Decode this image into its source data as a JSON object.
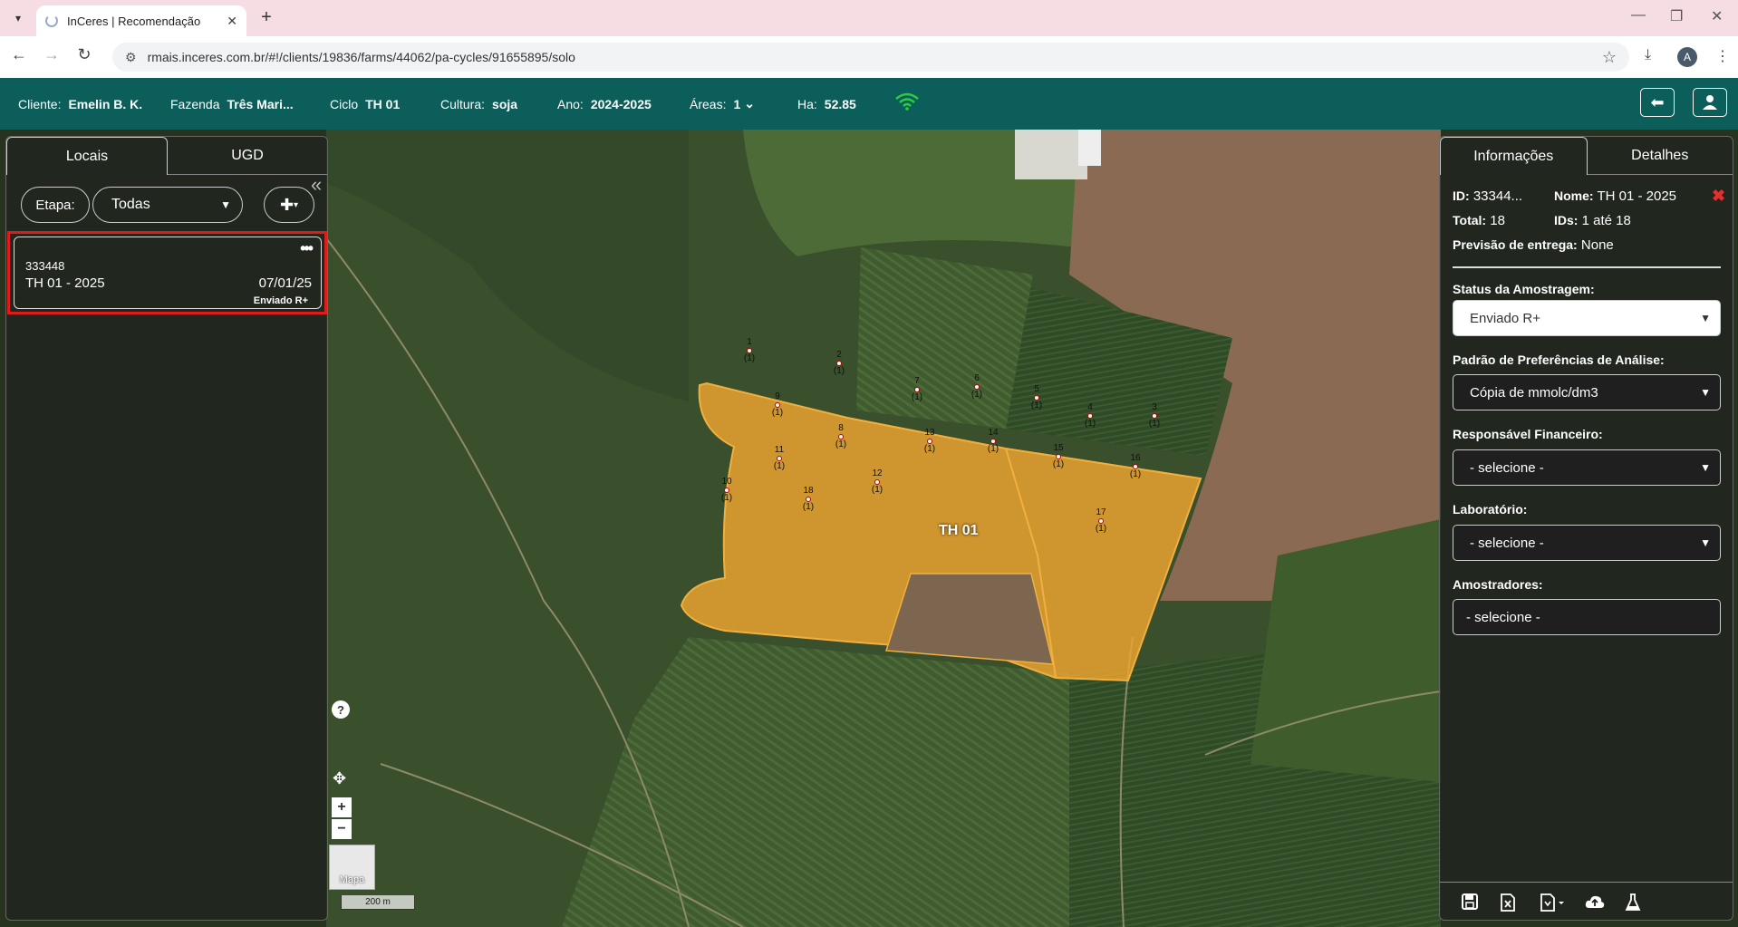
{
  "browser": {
    "tab_title": "InCeres | Recomendação",
    "url": "rmais.inceres.com.br/#!/clients/19836/farms/44062/pa-cycles/91655895/solo",
    "profile_initial": "A"
  },
  "header": {
    "cliente_label": "Cliente:",
    "cliente_value": "Emelin B. K.",
    "fazenda_label": "Fazenda",
    "fazenda_value": "Três Mari...",
    "ciclo_label": "Ciclo",
    "ciclo_value": "TH 01",
    "cultura_label": "Cultura:",
    "cultura_value": "soja",
    "ano_label": "Ano:",
    "ano_value": "2024-2025",
    "areas_label": "Áreas:",
    "areas_value": "1",
    "ha_label": "Ha:",
    "ha_value": "52.85"
  },
  "left_panel": {
    "tabs": [
      "Locais",
      "UGD"
    ],
    "etapa_label": "Etapa:",
    "etapa_select": "Todas",
    "card": {
      "id": "333448",
      "name": "TH 01 - 2025",
      "date": "07/01/25",
      "status": "Enviado R+"
    }
  },
  "right_panel": {
    "tabs": [
      "Informações",
      "Detalhes"
    ],
    "id_label": "ID:",
    "id_value": "33344...",
    "nome_label": "Nome:",
    "nome_value": "TH 01 - 2025",
    "total_label": "Total:",
    "total_value": "18",
    "ids_label": "IDs:",
    "ids_value": "1 até 18",
    "previsao_label": "Previsão de entrega:",
    "previsao_value": "None",
    "status_label": "Status da Amostragem:",
    "status_value": "Enviado R+",
    "padrao_label": "Padrão de Preferências de Análise:",
    "padrao_value": "Cópia de mmolc/dm3",
    "responsavel_label": "Responsável Financeiro:",
    "responsavel_value": "- selecione -",
    "laboratorio_label": "Laboratório:",
    "laboratorio_value": "- selecione -",
    "amostradores_label": "Amostradores:",
    "amostradores_value": "- selecione -"
  },
  "map": {
    "field_label": "TH 01",
    "scale_label": "200 m",
    "layer_thumb_label": "Mapa",
    "help": "?",
    "zoom_in": "+",
    "zoom_out": "−",
    "points": [
      {
        "n": "1",
        "c": "(1)"
      },
      {
        "n": "2",
        "c": "(1)"
      },
      {
        "n": "3",
        "c": "(1)"
      },
      {
        "n": "4",
        "c": "(1)"
      },
      {
        "n": "5",
        "c": "(1)"
      },
      {
        "n": "6",
        "c": "(1)"
      },
      {
        "n": "7",
        "c": "(1)"
      },
      {
        "n": "8",
        "c": "(1)"
      },
      {
        "n": "9",
        "c": "(1)"
      },
      {
        "n": "10",
        "c": "(1)"
      },
      {
        "n": "11",
        "c": "(1)"
      },
      {
        "n": "12",
        "c": "(1)"
      },
      {
        "n": "13",
        "c": "(1)"
      },
      {
        "n": "14",
        "c": "(1)"
      },
      {
        "n": "15",
        "c": "(1)"
      },
      {
        "n": "16",
        "c": "(1)"
      },
      {
        "n": "17",
        "c": "(1)"
      },
      {
        "n": "18",
        "c": "(1)"
      }
    ]
  },
  "colors": {
    "header_bg": "#0b5e5a",
    "field_fill": "#f0a630",
    "highlight": "#e01b1b"
  }
}
